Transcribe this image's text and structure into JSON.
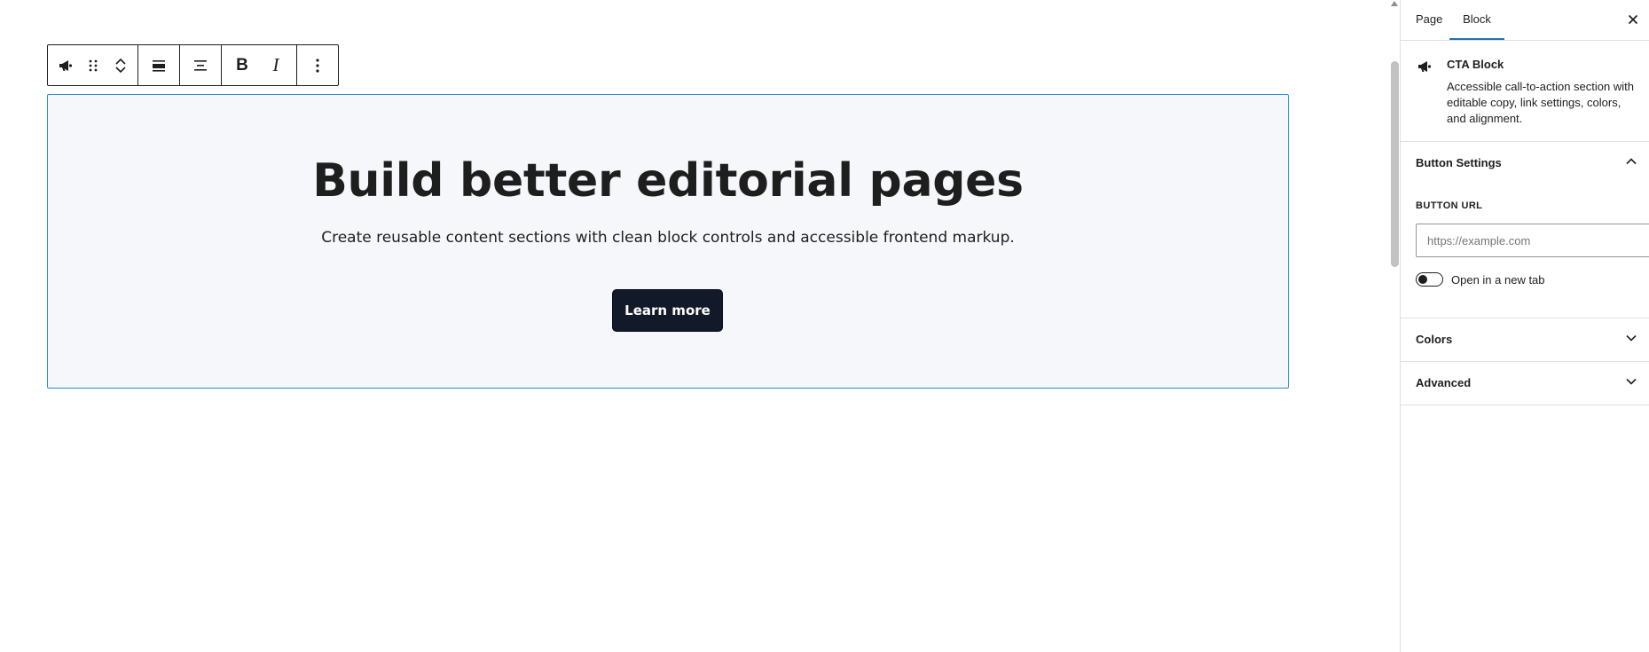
{
  "toolbar": {
    "buttons": [
      {
        "name": "block-type",
        "icon": "megaphone-icon"
      },
      {
        "name": "drag-handle",
        "icon": "drag-handle-icon"
      },
      {
        "name": "move-up",
        "icon": "chevron-up-icon"
      },
      {
        "name": "move-down",
        "icon": "chevron-down-icon"
      },
      {
        "name": "block-align",
        "icon": "align-full-icon"
      },
      {
        "name": "text-align",
        "icon": "align-center-icon"
      },
      {
        "name": "bold",
        "label": "B"
      },
      {
        "name": "italic",
        "label": "I"
      },
      {
        "name": "options",
        "icon": "more-vertical-icon"
      }
    ],
    "bold_label": "B",
    "italic_label": "I"
  },
  "cta": {
    "heading": "Build better editorial pages",
    "text": "Create reusable content sections with clean block controls and accessible frontend markup.",
    "button_label": "Learn more"
  },
  "sidebar": {
    "tabs": [
      {
        "label": "Page",
        "active": false
      },
      {
        "label": "Block",
        "active": true
      }
    ],
    "block": {
      "title": "CTA Block",
      "description": "Accessible call-to-action section with editable copy, link settings, colors, and alignment."
    },
    "sections": {
      "button_settings": {
        "title": "Button Settings",
        "expanded": true,
        "url_label": "BUTTON URL",
        "url_placeholder": "https://example.com",
        "url_value": "",
        "new_tab_label": "Open in a new tab",
        "new_tab_checked": false
      },
      "colors": {
        "title": "Colors",
        "expanded": false
      },
      "advanced": {
        "title": "Advanced",
        "expanded": false
      }
    }
  },
  "colors": {
    "accent": "#2271b1",
    "block_outline": "#2a8fce",
    "block_background": "#f6f7fa",
    "button_background": "#121a2a",
    "text": "#1e1e1e"
  }
}
